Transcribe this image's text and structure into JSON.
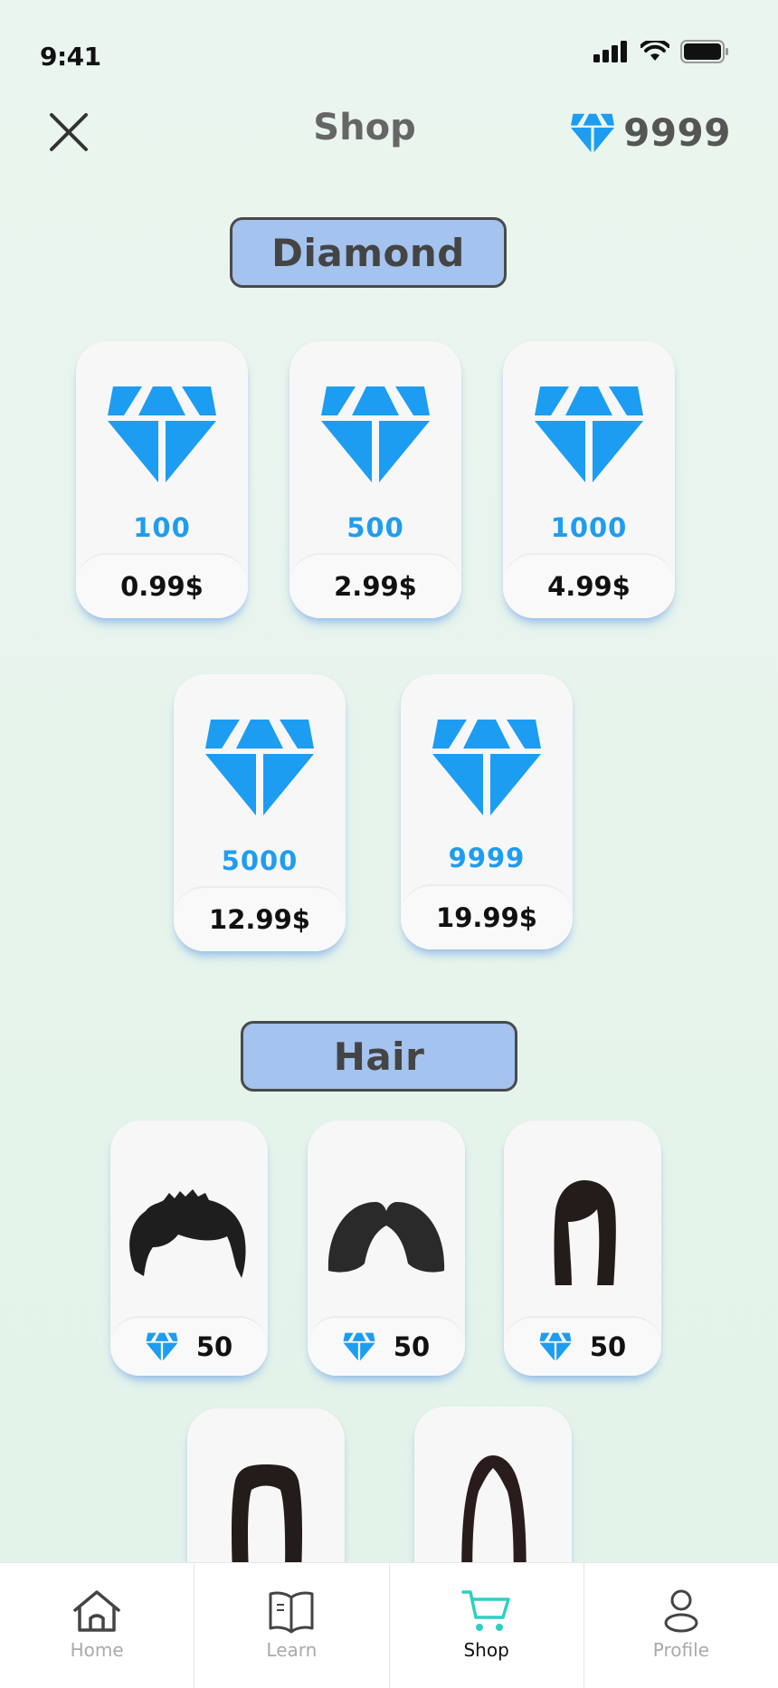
{
  "status_bar": {
    "time": "9:41"
  },
  "header": {
    "title": "Shop",
    "balance": "9999"
  },
  "colors": {
    "accent_blue": "#1f9df0",
    "section_pill": "#a4c3ee",
    "active_tab": "#2fcfc2"
  },
  "diamond_section": {
    "title": "Diamond",
    "items": [
      {
        "amount": "100",
        "price": "0.99$"
      },
      {
        "amount": "500",
        "price": "2.99$"
      },
      {
        "amount": "1000",
        "price": "4.99$"
      },
      {
        "amount": "5000",
        "price": "12.99$"
      },
      {
        "amount": "9999",
        "price": "19.99$"
      }
    ]
  },
  "hair_section": {
    "title": "Hair",
    "items": [
      {
        "icon": "short-spiky-hair-icon",
        "cost": "50"
      },
      {
        "icon": "bob-hair-icon",
        "cost": "50"
      },
      {
        "icon": "medium-bangs-hair-icon",
        "cost": "50"
      },
      {
        "icon": "long-straight-hair-icon",
        "cost": ""
      },
      {
        "icon": "long-parted-hair-icon",
        "cost": ""
      }
    ]
  },
  "tabs": [
    {
      "label": "Home",
      "icon": "home-icon"
    },
    {
      "label": "Learn",
      "icon": "book-icon"
    },
    {
      "label": "Shop",
      "icon": "cart-icon",
      "active": true
    },
    {
      "label": "Profile",
      "icon": "profile-icon"
    }
  ]
}
